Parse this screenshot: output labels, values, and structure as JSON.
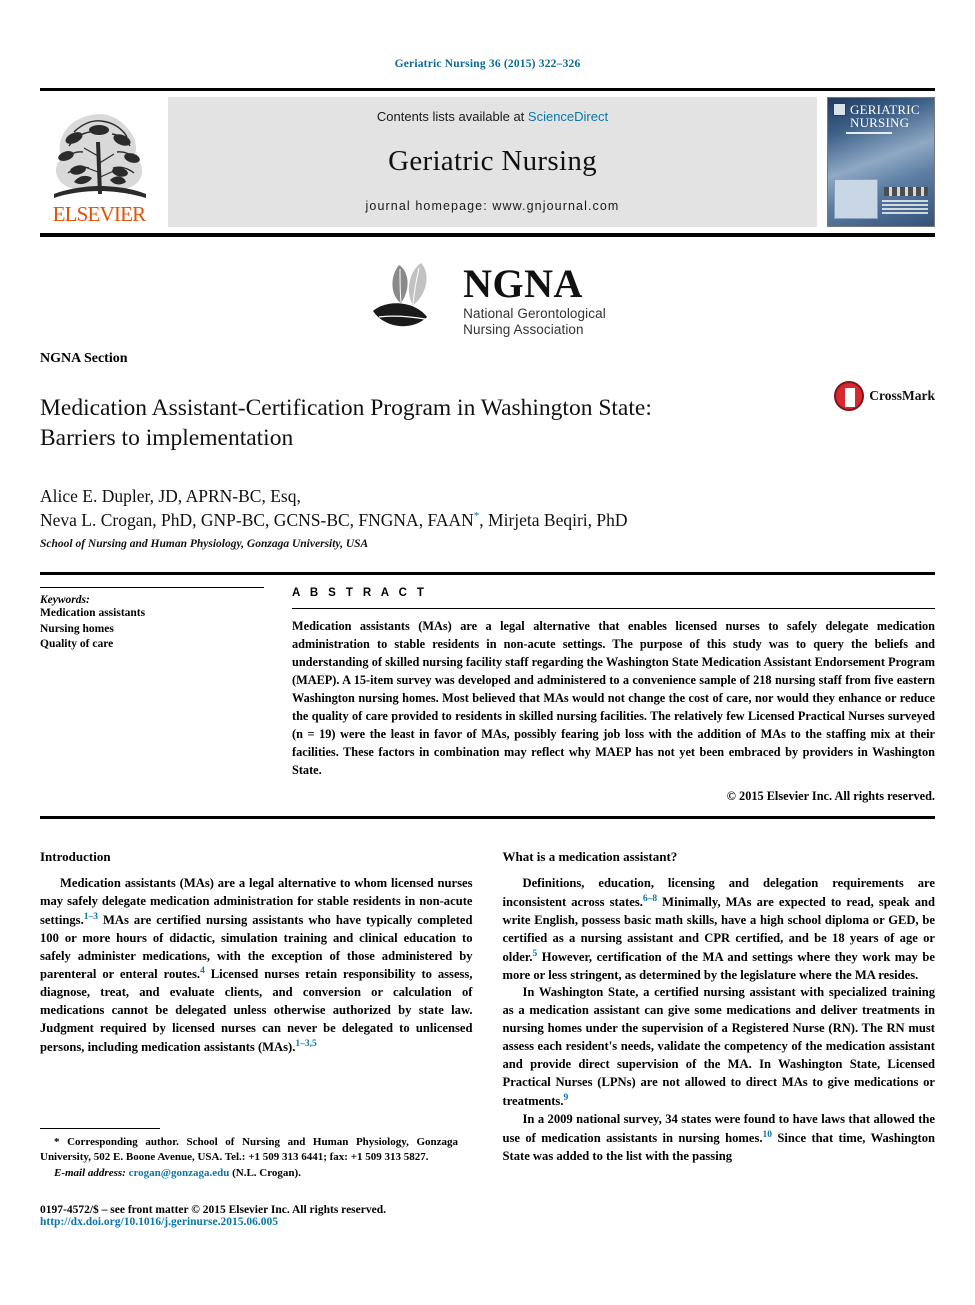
{
  "running_head": "Geriatric Nursing 36 (2015) 322–326",
  "masthead": {
    "contents_prefix": "Contents lists available at ",
    "sciencedirect": "ScienceDirect",
    "journal_title": "Geriatric Nursing",
    "homepage": "journal homepage: www.gnjournal.com",
    "publisher_wordmark": "ELSEVIER",
    "cover_title_line1": "GERIATRIC",
    "cover_title_line2": "NURSING"
  },
  "society_logo": {
    "acronym": "NGNA",
    "name_line1": "National Gerontological",
    "name_line2": "Nursing Association"
  },
  "article": {
    "section_label": "NGNA Section",
    "title_line1": "Medication Assistant-Certification Program in Washington State:",
    "title_line2": "Barriers to implementation",
    "crossmark_label": "CrossMark",
    "authors_line1": "Alice E. Dupler, JD, APRN-BC, Esq,",
    "authors_line2_pre": "Neva L. Crogan, PhD, GNP-BC, GCNS-BC, FNGNA, FAAN",
    "authors_corresponding_marker": "*",
    "authors_line2_post": ", Mirjeta Beqiri, PhD",
    "affiliation": "School of Nursing and Human Physiology, Gonzaga University, USA"
  },
  "keywords": {
    "label": "Keywords:",
    "items": [
      "Medication assistants",
      "Nursing homes",
      "Quality of care"
    ]
  },
  "abstract": {
    "heading": "A B S T R A C T",
    "text": "Medication assistants (MAs) are a legal alternative that enables licensed nurses to safely delegate medication administration to stable residents in non-acute settings. The purpose of this study was to query the beliefs and understanding of skilled nursing facility staff regarding the Washington State Medication Assistant Endorsement Program (MAEP). A 15-item survey was developed and administered to a convenience sample of 218 nursing staff from five eastern Washington nursing homes. Most believed that MAs would not change the cost of care, nor would they enhance or reduce the quality of care provided to residents in skilled nursing facilities. The relatively few Licensed Practical Nurses surveyed (n = 19) were the least in favor of MAs, possibly fearing job loss with the addition of MAs to the staffing mix at their facilities. These factors in combination may reflect why MAEP has not yet been embraced by providers in Washington State.",
    "copyright": "© 2015 Elsevier Inc. All rights reserved."
  },
  "columns": {
    "left": {
      "heading": "Introduction",
      "paragraph_1a": "Medication assistants (MAs) are a legal alternative to whom licensed nurses may safely delegate medication administration for stable residents in non-acute settings.",
      "ref_1": "1–3",
      "paragraph_1b": " MAs are certified nursing assistants who have typically completed 100 or more hours of didactic, simulation training and clinical education to safely administer medications, with the exception of those administered by parenteral or enteral routes.",
      "ref_2": "4",
      "paragraph_1c": " Licensed nurses retain responsibility to assess, diagnose, treat, and evaluate clients, and conversion or calculation of medications cannot be delegated unless otherwise authorized by state law. Judgment required by licensed nurses can never be delegated to unlicensed persons, including medication assistants (MAs).",
      "ref_3": "1–3,5"
    },
    "right": {
      "heading": "What is a medication assistant?",
      "paragraph_1a": "Definitions, education, licensing and delegation requirements are inconsistent across states.",
      "ref_1": "6–8",
      "paragraph_1b": " Minimally, MAs are expected to read, speak and write English, possess basic math skills, have a high school diploma or GED, be certified as a nursing assistant and CPR certified, and be 18 years of age or older.",
      "ref_2": "5",
      "paragraph_1c": " However, certification of the MA and settings where they work may be more or less stringent, as determined by the legislature where the MA resides.",
      "paragraph_2a": "In Washington State, a certified nursing assistant with specialized training as a medication assistant can give some medications and deliver treatments in nursing homes under the supervision of a Registered Nurse (RN). The RN must assess each resident's needs, validate the competency of the medication assistant and provide direct supervision of the MA. In Washington State, Licensed Practical Nurses (LPNs) are not allowed to direct MAs to give medications or treatments.",
      "ref_3": "9",
      "paragraph_3a": "In a 2009 national survey, 34 states were found to have laws that allowed the use of medication assistants in nursing homes.",
      "ref_4": "10",
      "paragraph_3b": " Since that time, Washington State was added to the list with the passing"
    }
  },
  "footnote": {
    "marker": "*",
    "text": " Corresponding author. School of Nursing and Human Physiology, Gonzaga University, 502 E. Boone Avenue, USA. Tel.: +1 509 313 6441; fax: +1 509 313 5827.",
    "email_label": "E-mail address:",
    "email": "crogan@gonzaga.edu",
    "email_owner": " (N.L. Crogan)."
  },
  "imprint": {
    "issn_line": "0197-4572/$ – see front matter © 2015 Elsevier Inc. All rights reserved.",
    "doi": "http://dx.doi.org/10.1016/j.gerinurse.2015.06.005"
  },
  "colors": {
    "link": "#0b76a8",
    "running_head": "#0b6a93",
    "elsevier_orange": "#E35205",
    "crossmark_red": "#d7282f"
  }
}
